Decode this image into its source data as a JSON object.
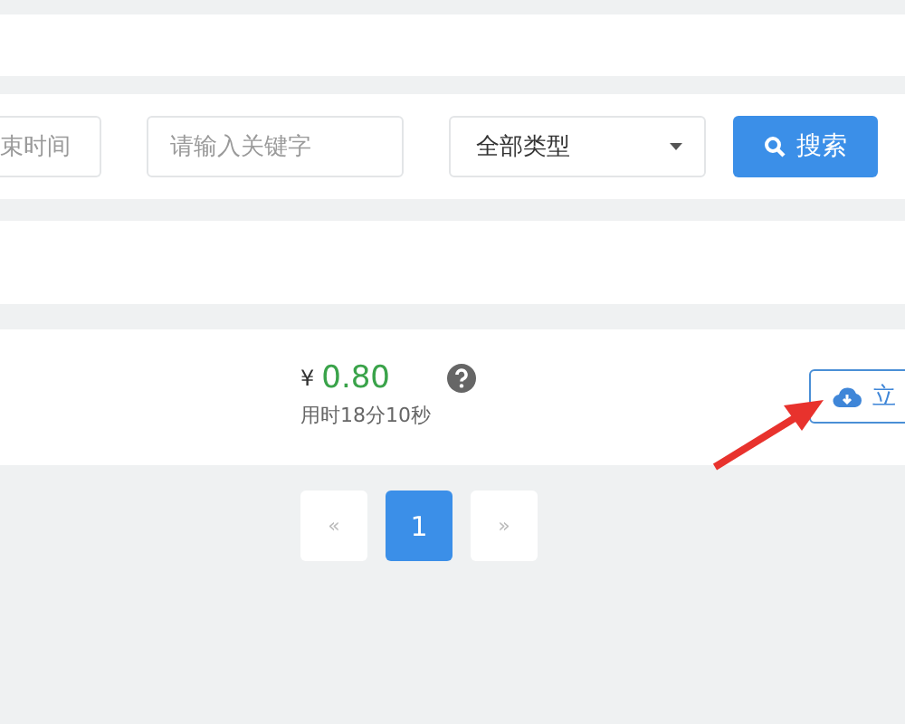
{
  "search_bar": {
    "end_time_field": {
      "placeholder": "束时间"
    },
    "keyword_field": {
      "placeholder": "请输入关键字"
    },
    "type_select": {
      "value": "全部类型"
    },
    "search_button": {
      "label": "搜索"
    }
  },
  "record": {
    "currency": "¥",
    "price": "0.80",
    "duration": "用时18分10秒",
    "action_button": {
      "label": "立"
    }
  },
  "pagination": [
    {
      "label": "«",
      "selected": false
    },
    {
      "label": "1",
      "selected": true
    },
    {
      "label": "»",
      "selected": false
    }
  ]
}
